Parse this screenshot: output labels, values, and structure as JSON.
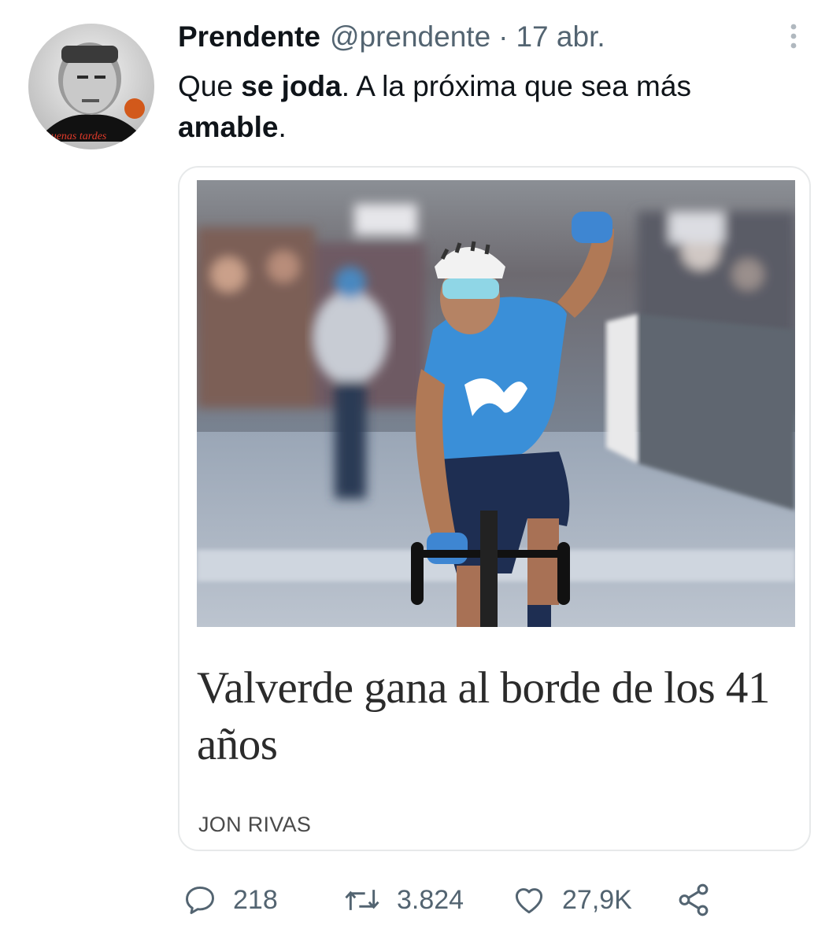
{
  "tweet": {
    "author": {
      "name": "Prendente",
      "handle": "@prendente",
      "avatar_icon": "profile-photo",
      "avatar_caption": "y buenas tardes"
    },
    "separator": "·",
    "date": "17 abr.",
    "text": {
      "p1": "Que ",
      "b1": "se joda",
      "p2": ". A la próxima que sea más ",
      "b2": "amable",
      "p3": "."
    },
    "card": {
      "image_icon": "cyclist-celebrating-photo",
      "headline": "Valverde gana al borde de los 41 años",
      "author": "JON RIVAS"
    },
    "actions": {
      "reply_count": "218",
      "retweet_count": "3.824",
      "like_count": "27,9K"
    },
    "icons": {
      "more": "more-options-icon",
      "reply": "reply-icon",
      "retweet": "retweet-icon",
      "like": "heart-icon",
      "share": "share-icon"
    }
  },
  "colors": {
    "text": "#0f1419",
    "secondary": "#536471",
    "border": "#e7e9ea",
    "jersey": "#3a8fd8"
  }
}
